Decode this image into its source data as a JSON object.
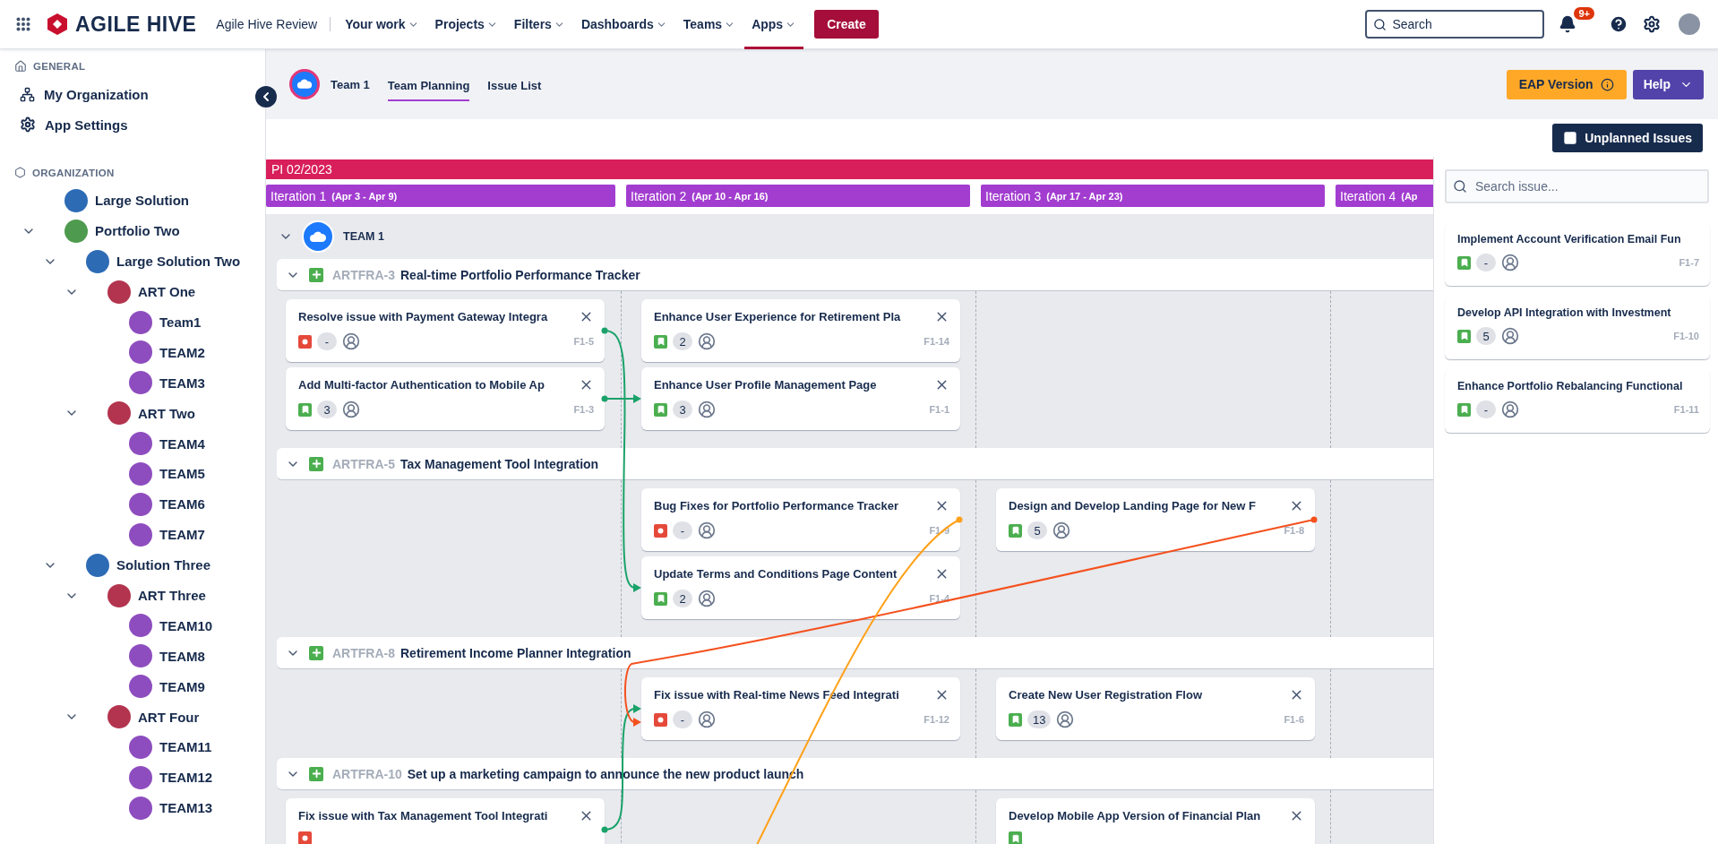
{
  "topbar": {
    "brand": "AGILE HIVE",
    "site": "Agile Hive Review",
    "nav": [
      {
        "label": "Your work",
        "selected": false
      },
      {
        "label": "Projects",
        "selected": false
      },
      {
        "label": "Filters",
        "selected": false
      },
      {
        "label": "Dashboards",
        "selected": false
      },
      {
        "label": "Teams",
        "selected": false
      },
      {
        "label": "Apps",
        "selected": true
      }
    ],
    "create": "Create",
    "search": {
      "placeholder": "Search"
    },
    "notifications": "9+"
  },
  "sidebar": {
    "general": {
      "heading": "GENERAL",
      "items": [
        "My Organization",
        "App Settings"
      ]
    },
    "organization": {
      "heading": "ORGANIZATION",
      "tree": [
        {
          "label": "Large Solution",
          "kind": "solution"
        },
        {
          "label": "Portfolio Two",
          "kind": "portfolio",
          "expanded": true,
          "children": [
            {
              "label": "Large Solution Two",
              "kind": "solution",
              "expanded": true,
              "children": [
                {
                  "label": "ART One",
                  "kind": "art",
                  "expanded": true,
                  "children": [
                    {
                      "label": "Team1",
                      "kind": "team"
                    },
                    {
                      "label": "TEAM2",
                      "kind": "team"
                    },
                    {
                      "label": "TEAM3",
                      "kind": "team"
                    }
                  ]
                },
                {
                  "label": "ART Two",
                  "kind": "art",
                  "expanded": true,
                  "children": [
                    {
                      "label": "TEAM4",
                      "kind": "team"
                    },
                    {
                      "label": "TEAM5",
                      "kind": "team"
                    },
                    {
                      "label": "TEAM6",
                      "kind": "team"
                    },
                    {
                      "label": "TEAM7",
                      "kind": "team"
                    }
                  ]
                }
              ]
            },
            {
              "label": "Solution Three",
              "kind": "solution",
              "expanded": true,
              "children": [
                {
                  "label": "ART Three",
                  "kind": "art",
                  "expanded": true,
                  "children": [
                    {
                      "label": "TEAM10",
                      "kind": "team"
                    },
                    {
                      "label": "TEAM8",
                      "kind": "team"
                    },
                    {
                      "label": "TEAM9",
                      "kind": "team"
                    }
                  ]
                },
                {
                  "label": "ART Four",
                  "kind": "art",
                  "expanded": true,
                  "children": [
                    {
                      "label": "TEAM11",
                      "kind": "team"
                    },
                    {
                      "label": "TEAM12",
                      "kind": "team"
                    },
                    {
                      "label": "TEAM13",
                      "kind": "team"
                    }
                  ]
                }
              ]
            }
          ]
        }
      ]
    }
  },
  "header": {
    "team": "Team 1",
    "tabs": [
      {
        "label": "Team Planning",
        "selected": true
      },
      {
        "label": "Issue List",
        "selected": false
      }
    ],
    "eap": "EAP Version",
    "help": "Help"
  },
  "toolbar": {
    "unplanned": "Unplanned Issues"
  },
  "pi": "PI 02/2023",
  "iterations": [
    {
      "name": "Iteration 1",
      "dates": "(Apr 3 - Apr 9)"
    },
    {
      "name": "Iteration 2",
      "dates": "(Apr 10 - Apr 16)"
    },
    {
      "name": "Iteration 3",
      "dates": "(Apr 17 - Apr 23)"
    },
    {
      "name": "Iteration 4",
      "dates": "(Ap"
    }
  ],
  "team_row": {
    "name": "TEAM 1",
    "expanded": true
  },
  "features": [
    {
      "key": "ARTFRA-3",
      "title": "Real-time Portfolio Performance Tracker",
      "expanded": true,
      "cells": [
        [
          {
            "title": "Resolve issue with Payment Gateway Integra",
            "kind": "bug",
            "points": "-",
            "key": "F1-5"
          },
          {
            "title": "Add Multi-factor Authentication to Mobile Ap",
            "kind": "story",
            "points": "3",
            "key": "F1-3"
          }
        ],
        [
          {
            "title": "Enhance User Experience for Retirement Pla",
            "kind": "story",
            "points": "2",
            "key": "F1-14"
          },
          {
            "title": "Enhance User Profile Management Page",
            "kind": "story",
            "points": "3",
            "key": "F1-1"
          }
        ],
        [],
        []
      ]
    },
    {
      "key": "ARTFRA-5",
      "title": "Tax Management Tool Integration",
      "expanded": true,
      "cells": [
        [],
        [
          {
            "title": "Bug Fixes for Portfolio Performance Tracker",
            "kind": "bug",
            "points": "-",
            "key": "F1-9"
          },
          {
            "title": "Update Terms and Conditions Page Content",
            "kind": "story",
            "points": "2",
            "key": "F1-4"
          }
        ],
        [
          {
            "title": "Design and Develop Landing Page for New F",
            "kind": "story",
            "points": "5",
            "key": "F1-8"
          }
        ],
        []
      ]
    },
    {
      "key": "ARTFRA-8",
      "title": "Retirement Income Planner Integration",
      "expanded": true,
      "cells": [
        [],
        [
          {
            "title": "Fix issue with Real-time News Feed Integrati",
            "kind": "bug",
            "points": "-",
            "key": "F1-12"
          }
        ],
        [
          {
            "title": "Create New User Registration Flow",
            "kind": "story",
            "points": "13",
            "key": "F1-6"
          }
        ],
        []
      ]
    },
    {
      "key": "ARTFRA-10",
      "title": "Set up a marketing campaign to announce the new product launch",
      "expanded": true,
      "cells": [
        [
          {
            "title": "Fix issue with Tax Management Tool Integrati",
            "kind": "bug"
          }
        ],
        [],
        [
          {
            "title": "Develop Mobile App Version of Financial Plan",
            "kind": "story"
          }
        ],
        []
      ]
    }
  ],
  "unplanned": {
    "placeholder": "Search issue...",
    "issues": [
      {
        "title": "Implement Account Verification Email Fun",
        "kind": "story",
        "points": "-",
        "key": "F1-7"
      },
      {
        "title": "Develop API Integration with Investment",
        "kind": "story",
        "points": "5",
        "key": "F1-10"
      },
      {
        "title": "Enhance Portfolio Rebalancing Functional",
        "kind": "story",
        "points": "-",
        "key": "F1-11"
      }
    ]
  }
}
